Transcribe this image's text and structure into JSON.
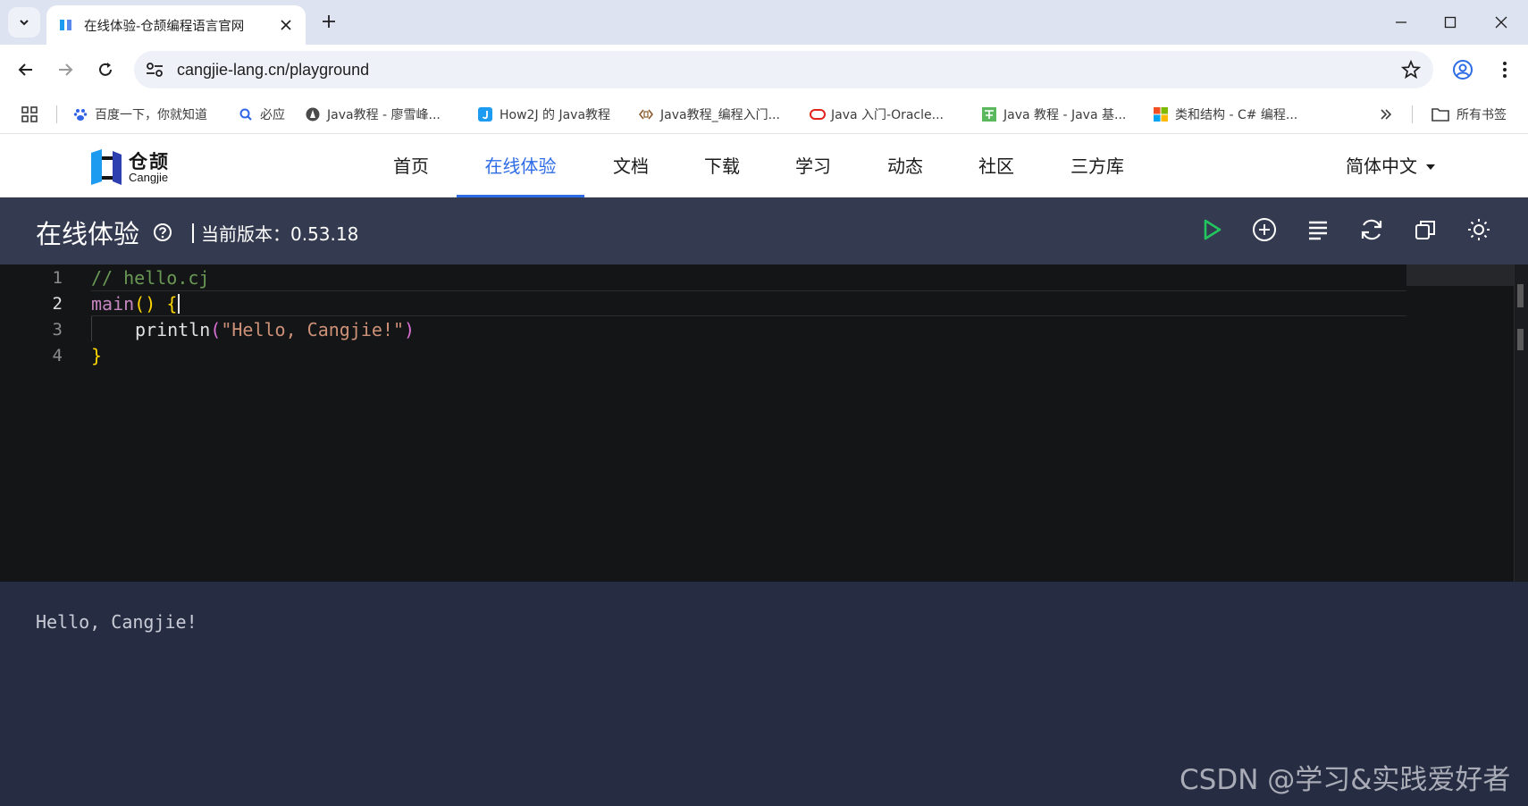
{
  "browser": {
    "tab_title": "在线体验-仓颉编程语言官网",
    "url": "cangjie-lang.cn/playground"
  },
  "bookmarks": {
    "items": [
      {
        "label": "百度一下，你就知道",
        "icon": "baidu-paw-icon"
      },
      {
        "label": "必应",
        "icon": "bing-search-icon"
      },
      {
        "label": "Java教程 - 廖雪峰...",
        "icon": "liaoxuefeng-icon"
      },
      {
        "label": "How2J 的 Java教程",
        "icon": "how2j-icon"
      },
      {
        "label": "Java教程_编程入门...",
        "icon": "code-brackets-icon"
      },
      {
        "label": "Java 入门-Oracle...",
        "icon": "oracle-icon"
      },
      {
        "label": "Java 教程 - Java 基...",
        "icon": "runoob-icon"
      },
      {
        "label": "类和结构 - C# 编程...",
        "icon": "microsoft-icon"
      }
    ],
    "all_bookmarks_label": "所有书签"
  },
  "site": {
    "logo_cn": "仓颉",
    "logo_en": "Cangjie",
    "nav": [
      "首页",
      "在线体验",
      "文档",
      "下载",
      "学习",
      "动态",
      "社区",
      "三方库"
    ],
    "active_nav": "在线体验",
    "language": "简体中文"
  },
  "playground": {
    "title": "在线体验",
    "version_label": "当前版本：",
    "version": "0.53.18",
    "tools": [
      "run-icon",
      "add-circle-icon",
      "format-lines-icon",
      "refresh-icon",
      "copy-icon",
      "theme-sun-icon"
    ]
  },
  "editor": {
    "line_numbers": [
      "1",
      "2",
      "3",
      "4"
    ],
    "code": {
      "comment": "// hello.cj",
      "main_fn": "main",
      "main_parens": "()",
      "open_brace": "{",
      "println_fn": "println",
      "open_paren": "(",
      "string": "\"Hello, Cangjie!\"",
      "close_paren": ")",
      "close_brace": "}"
    },
    "colors": {
      "background": "#141517",
      "comment": "#6a9955",
      "string": "#ce9178",
      "brace": "#ffd700"
    }
  },
  "output": {
    "text": "Hello, Cangjie!"
  },
  "watermark": "CSDN @学习&实践爱好者",
  "colors": {
    "accent": "#2e6ce6",
    "header_bg": "#343b50",
    "output_bg": "#262d42",
    "run_green": "#22c55e"
  }
}
